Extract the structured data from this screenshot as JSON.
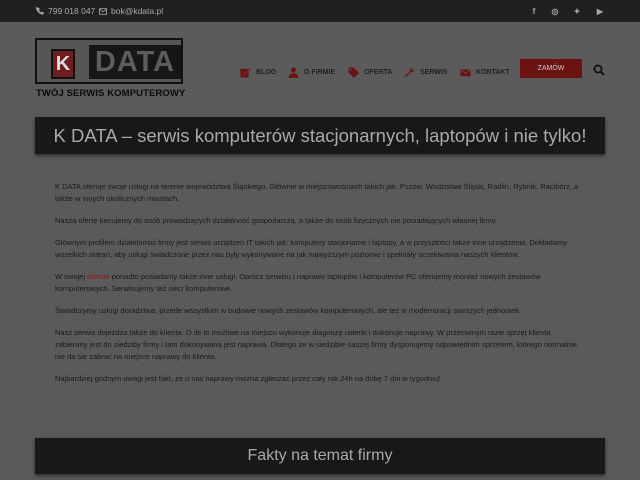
{
  "topbar": {
    "phone": "799 018 047",
    "email": "bok@kdata.pl",
    "social": [
      {
        "icon": "facebook-icon",
        "glyph": "f"
      },
      {
        "icon": "instagram-icon",
        "glyph": "◎"
      },
      {
        "icon": "twitter-icon",
        "glyph": "✦"
      },
      {
        "icon": "youtube-icon",
        "glyph": "▶"
      }
    ]
  },
  "logo": {
    "letter": "K",
    "word": "DATA",
    "tagline": "TWÓJ SERWIS KOMPUTEROWY"
  },
  "nav": {
    "items": [
      {
        "label": "BLOG",
        "icon": "edit-icon"
      },
      {
        "label": "O FIRMIE",
        "icon": "user-icon"
      },
      {
        "label": "OFERTA",
        "icon": "tag-icon"
      },
      {
        "label": "SERWIS",
        "icon": "wrench-icon"
      },
      {
        "label": "KONTAKT",
        "icon": "envelope-icon"
      }
    ],
    "order_label": "ZAMÓW"
  },
  "hero": {
    "title": "K DATA – serwis komputerów stacjonarnych, laptopów i nie tylko!"
  },
  "content": {
    "p1": "K DATA oferuje swoje usługi na terenie województwa Śląskiego. Głównie w miejscowościach takich jak: Pszów, Wodzisław Śląski, Radlin, Rybnik, Racibórz, a także w innych okolicznych miastach.",
    "p2": "Naszą ofertę kierujemy do osób prowadzących działalność gospodarczą, a także do osób fizycznych nie posiadających własnej firmy.",
    "p3": "Głównym profilem działalności firmy jest serwis urządzeń IT takich jak: komputery stacjonarne i laptopy, a w przyszłości także inne urządzenia. Dokładamy wszelkich starań, aby usługi świadczone przez nas były wykonywane na jak najwyższym poziomie i spełniały oczekiwania naszych klientów.",
    "p4_before": "W swojej ",
    "p4_link": "ofercie",
    "p4_after": " ponadto posiadamy także inne usługi. Oprócz serwisu i naprawy laptopów i komputerów PC oferujemy montaż nowych zestawów komputerowych. Serwisujemy też sieci komputerowe.",
    "p5": "Świadczymy usługi doradztwa, przede wszystkim w budowie nowych zestawów komputerowych, ale też w modernizacji starszych jednostek.",
    "p6": "Nasz serwis dojeżdża także do klienta. O ile to możliwe na miejscu wykonuje diagnozę usterki i dokonuje naprawy. W przeciwnym razie sprzęt klienta zabierany jest do siedziby firmy i tam dokonywana jest naprawa. Dlatego że w siedzibie naszej firmy dysponujemy odpowiednim sprzętem, którego normalnie nie da się zabrać na miejsce naprawy do klienta.",
    "p7": "Najbardziej godnym uwagi jest fakt, że u nas naprawy można zgłaszać przez cały rok 24h na dobę 7 dni w tygodniu!"
  },
  "facts": {
    "title": "Fakty na temat firmy"
  },
  "colors": {
    "topbar_bg": "#202020",
    "page_bg": "#5a5a5a",
    "accent_red": "#6b1313",
    "hero_bg": "#181818"
  }
}
